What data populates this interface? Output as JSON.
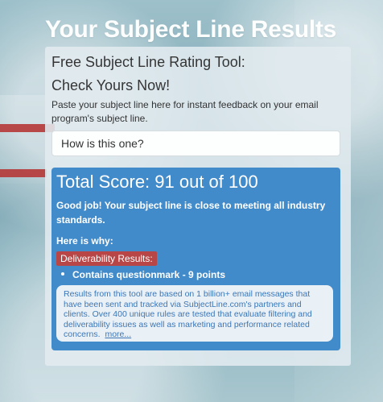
{
  "page": {
    "title": "Your Subject Line Results"
  },
  "tool": {
    "title_line1": "Free Subject Line Rating Tool:",
    "title_line2": "Check Yours Now!",
    "instructions": "Paste your subject line here for instant feedback on your email program's subject line.",
    "input": {
      "value": "How is this one?",
      "placeholder": ""
    }
  },
  "results": {
    "score_text": "Total Score: 91 out of 100",
    "summary": "Good job! Your subject line is close to meeting all industry standards.",
    "here_is_why": "Here is why:",
    "deliverability_label": "Deliverability Results:",
    "items": [
      {
        "text": "Contains questionmark - 9 points"
      }
    ],
    "disclaimer": "Results from this tool are based on 1 billion+ email messages that have been sent and tracked via SubjectLine.com's partners and clients. Over 400 unique rules are tested that evaluate filtering and deliverability issues as well as marketing and performance related concerns.",
    "more_link": "more..."
  },
  "colors": {
    "results_panel": "#428bca",
    "badge": "#b84646",
    "disclaimer_text": "#3a76b8"
  }
}
